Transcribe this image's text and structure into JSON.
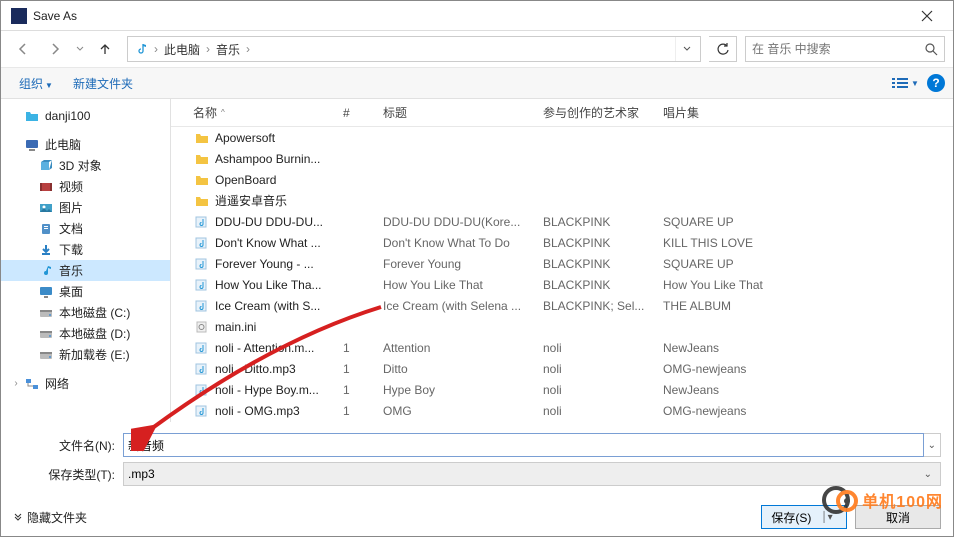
{
  "window": {
    "title": "Save As"
  },
  "nav": {
    "breadcrumb": [
      "此电脑",
      "音乐"
    ],
    "search_placeholder": "在 音乐 中搜索"
  },
  "toolbar": {
    "organize": "组织",
    "new_folder": "新建文件夹"
  },
  "sidebar": {
    "quick": {
      "label": "danji100"
    },
    "this_pc": {
      "label": "此电脑"
    },
    "items": [
      {
        "label": "3D 对象",
        "icon": "3d"
      },
      {
        "label": "视频",
        "icon": "video"
      },
      {
        "label": "图片",
        "icon": "picture"
      },
      {
        "label": "文档",
        "icon": "document"
      },
      {
        "label": "下载",
        "icon": "download"
      },
      {
        "label": "音乐",
        "icon": "music",
        "selected": true
      },
      {
        "label": "桌面",
        "icon": "desktop"
      },
      {
        "label": "本地磁盘 (C:)",
        "icon": "disk"
      },
      {
        "label": "本地磁盘 (D:)",
        "icon": "disk"
      },
      {
        "label": "新加载卷 (E:)",
        "icon": "disk"
      }
    ],
    "network": {
      "label": "网络"
    }
  },
  "columns": {
    "name": "名称",
    "track": "#",
    "title": "标题",
    "artist": "参与创作的艺术家",
    "album": "唱片集"
  },
  "files": [
    {
      "name": "Apowersoft",
      "type": "folder"
    },
    {
      "name": "Ashampoo Burnin...",
      "type": "folder"
    },
    {
      "name": "OpenBoard",
      "type": "folder"
    },
    {
      "name": "逍遥安卓音乐",
      "type": "folder"
    },
    {
      "name": "DDU-DU DDU-DU...",
      "type": "music",
      "title": "DDU-DU DDU-DU(Kore...",
      "artist": "BLACKPINK",
      "album": "SQUARE UP"
    },
    {
      "name": "Don't Know What ...",
      "type": "music",
      "title": "Don't Know What To Do",
      "artist": "BLACKPINK",
      "album": "KILL THIS LOVE"
    },
    {
      "name": "Forever Young - ...",
      "type": "music",
      "title": "Forever Young",
      "artist": "BLACKPINK",
      "album": "SQUARE UP"
    },
    {
      "name": "How You Like Tha...",
      "type": "music",
      "title": "How You Like That",
      "artist": "BLACKPINK",
      "album": "How You Like That"
    },
    {
      "name": "Ice Cream (with S...",
      "type": "music",
      "title": "Ice Cream (with Selena ...",
      "artist": "BLACKPINK; Sel...",
      "album": "THE ALBUM"
    },
    {
      "name": "main.ini",
      "type": "ini"
    },
    {
      "name": "noli - Attention.m...",
      "type": "music",
      "track": "1",
      "title": "Attention",
      "artist": "noli",
      "album": "NewJeans"
    },
    {
      "name": "noli - Ditto.mp3",
      "type": "music",
      "track": "1",
      "title": "Ditto",
      "artist": "noli",
      "album": "OMG-newjeans"
    },
    {
      "name": "noli - Hype Boy.m...",
      "type": "music",
      "track": "1",
      "title": "Hype Boy",
      "artist": "noli",
      "album": "NewJeans"
    },
    {
      "name": "noli - OMG.mp3",
      "type": "music",
      "track": "1",
      "title": "OMG",
      "artist": "noli",
      "album": "OMG-newjeans"
    }
  ],
  "form": {
    "filename_label": "文件名(N):",
    "filename_value": "新音频",
    "filetype_label": "保存类型(T):",
    "filetype_value": ".mp3"
  },
  "footer": {
    "hide_folders": "隐藏文件夹",
    "save": "保存(S)",
    "cancel": "取消"
  },
  "watermark": {
    "text": "单机100网"
  }
}
